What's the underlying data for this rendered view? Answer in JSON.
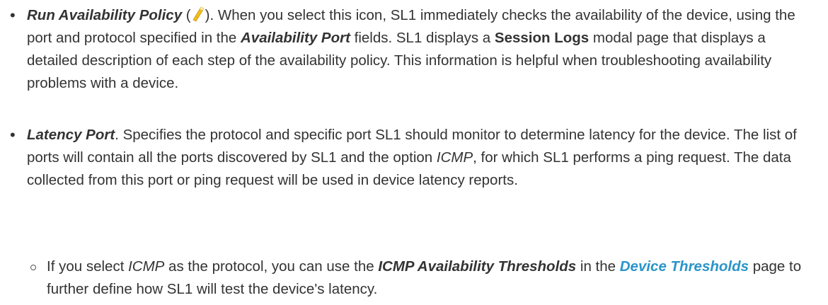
{
  "item1": {
    "term": "Run Availability Policy",
    "icon": "lightning-wand-icon",
    "icon_color": "#f2c019",
    "open_paren": " (",
    "close_paren": ").",
    "t1": " When you select this icon, SL1 immediately checks the availability of the device, using the port and protocol specified in the ",
    "field": "Availability Port",
    "t2": " fields. SL1 displays a ",
    "session_logs": "Session Logs",
    "t3": " modal page that displays a detailed description of each step of the availability policy. This information is helpful when troubleshooting availability problems with a device."
  },
  "item2": {
    "term": "Latency Port",
    "t1": ". Specifies the protocol and specific port SL1 should monitor to determine latency for the device. The list of ports will contain all the ports discovered by SL1 and the option ",
    "icmp": "ICMP",
    "t2": ", for which SL1 performs a ping request. The data collected from this port or ping request will be used in device latency reports."
  },
  "sub": {
    "t1": "If you select ",
    "icmp": "ICMP",
    "t2": " as the protocol, you can use the ",
    "thresholds": "ICMP Availability Thresholds",
    "t3": " in the ",
    "link": "Device Thresholds",
    "t4": " page to further define how SL1 will test the device's latency."
  },
  "colors": {
    "text": "#333333",
    "link": "#2a94c9"
  }
}
